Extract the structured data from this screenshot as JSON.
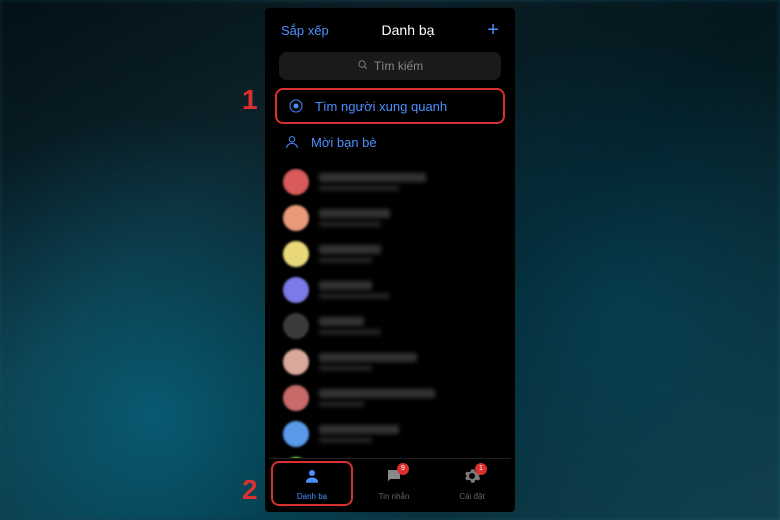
{
  "header": {
    "sort_label": "Sắp xếp",
    "title": "Danh bạ",
    "add_label": "+"
  },
  "search": {
    "placeholder": "Tìm kiếm"
  },
  "actions": {
    "nearby": "Tìm người xung quanh",
    "invite": "Mời bạn bè"
  },
  "contacts": [
    {
      "color": "#d85a5a",
      "nameW": "60%",
      "subW": "45%"
    },
    {
      "color": "#e89a7a",
      "nameW": "40%",
      "subW": "35%"
    },
    {
      "color": "#e8d87a",
      "nameW": "35%",
      "subW": "30%"
    },
    {
      "color": "#7a7ae8",
      "nameW": "30%",
      "subW": "40%"
    },
    {
      "color": "#3a3a3a",
      "nameW": "25%",
      "subW": "35%"
    },
    {
      "color": "#d8a89a",
      "nameW": "55%",
      "subW": "30%"
    },
    {
      "color": "#c86a6a",
      "nameW": "65%",
      "subW": "25%"
    },
    {
      "color": "#5a9ae8",
      "nameW": "45%",
      "subW": "30%"
    },
    {
      "color": "#7ad85a",
      "nameW": "20%",
      "subW": "35%"
    },
    {
      "color": "#4a4a4a",
      "nameW": "40%",
      "subW": "25%"
    }
  ],
  "nav": {
    "contacts": {
      "label": "Danh bạ"
    },
    "messages": {
      "label": "Tin nhắn",
      "badge": "9"
    },
    "settings": {
      "label": "Cài đặt",
      "badge": "1"
    }
  },
  "callouts": {
    "one": "1",
    "two": "2"
  }
}
